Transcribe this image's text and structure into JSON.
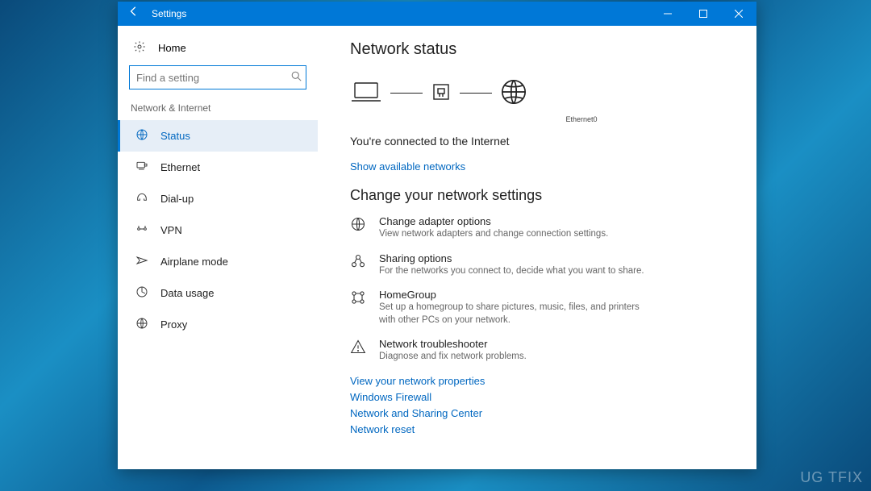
{
  "titlebar": {
    "title": "Settings"
  },
  "sidebar": {
    "home": "Home",
    "search_placeholder": "Find a setting",
    "category": "Network & Internet",
    "items": [
      {
        "icon": "status-icon",
        "label": "Status",
        "active": true
      },
      {
        "icon": "ethernet-icon",
        "label": "Ethernet"
      },
      {
        "icon": "dialup-icon",
        "label": "Dial-up"
      },
      {
        "icon": "vpn-icon",
        "label": "VPN"
      },
      {
        "icon": "airplane-icon",
        "label": "Airplane mode"
      },
      {
        "icon": "datausage-icon",
        "label": "Data usage"
      },
      {
        "icon": "proxy-icon",
        "label": "Proxy"
      }
    ]
  },
  "main": {
    "page_title": "Network status",
    "connection_name": "Ethernet0",
    "status_text": "You're connected to the Internet",
    "show_networks": "Show available networks",
    "section_title": "Change your network settings",
    "settings": [
      {
        "title": "Change adapter options",
        "desc": "View network adapters and change connection settings."
      },
      {
        "title": "Sharing options",
        "desc": "For the networks you connect to, decide what you want to share."
      },
      {
        "title": "HomeGroup",
        "desc": "Set up a homegroup to share pictures, music, files, and printers with other PCs on your network."
      },
      {
        "title": "Network troubleshooter",
        "desc": "Diagnose and fix network problems."
      }
    ],
    "links": [
      "View your network properties",
      "Windows Firewall",
      "Network and Sharing Center",
      "Network reset"
    ]
  },
  "watermark": "UG  TFIX"
}
